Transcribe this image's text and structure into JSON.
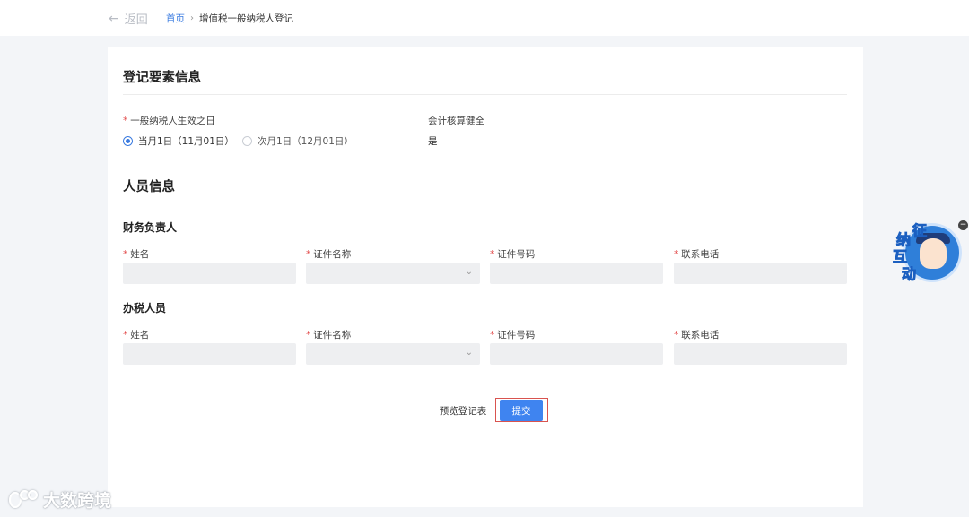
{
  "nav": {
    "back_label": "返回",
    "breadcrumb_home": "首页",
    "breadcrumb_separator": "›",
    "breadcrumb_current": "增值税一般纳税人登记"
  },
  "registration": {
    "section_title": "登记要素信息",
    "effective_date_label": "一般纳税人生效之日",
    "required_mark": "*",
    "option_current_month": "当月1日（11月01日）",
    "option_next_month": "次月1日（12月01日）",
    "selected_option": "当月1日（11月01日）",
    "accounting_label": "会计核算健全",
    "accounting_value": "是"
  },
  "personnel": {
    "section_title": "人员信息",
    "finance_head": {
      "title": "财务负责人",
      "name_label": "姓名",
      "id_type_label": "证件名称",
      "id_number_label": "证件号码",
      "phone_label": "联系电话"
    },
    "tax_officer": {
      "title": "办税人员",
      "name_label": "姓名",
      "id_type_label": "证件名称",
      "id_number_label": "证件号码",
      "phone_label": "联系电话"
    }
  },
  "actions": {
    "preview_label": "预览登记表",
    "submit_label": "提交"
  },
  "widget": {
    "chars": [
      "征",
      "纳",
      "互",
      "动"
    ],
    "close_label": "−"
  },
  "watermark": {
    "text": "大数跨境"
  },
  "colors": {
    "accent": "#3f84f0",
    "required": "#e34d4d",
    "highlight_frame": "#d9534f"
  }
}
